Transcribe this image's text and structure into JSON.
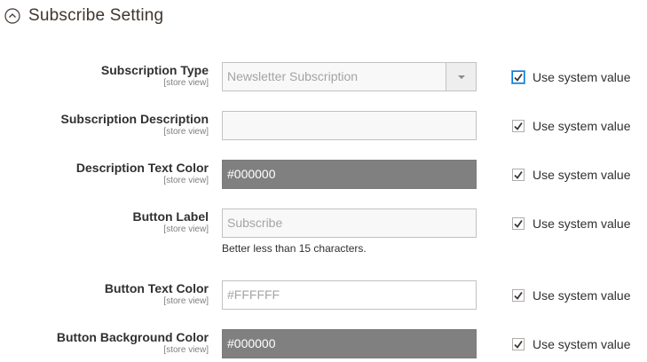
{
  "section": {
    "title": "Subscribe Setting",
    "icon": "collapse-circle-icon"
  },
  "fields": [
    {
      "label": "Subscription Type",
      "scope": "[store view]",
      "value": "Newsletter Subscription",
      "use_system": "Use system value",
      "checked": true
    },
    {
      "label": "Subscription Description",
      "scope": "[store view]",
      "value": "",
      "use_system": "Use system value",
      "checked": true
    },
    {
      "label": "Description Text Color",
      "scope": "[store view]",
      "value": "#000000",
      "use_system": "Use system value",
      "checked": true
    },
    {
      "label": "Button Label",
      "scope": "[store view]",
      "value": "Subscribe",
      "note": "Better less than 15 characters.",
      "use_system": "Use system value",
      "checked": true
    },
    {
      "label": "Button Text Color",
      "scope": "[store view]",
      "value": "#FFFFFF",
      "use_system": "Use system value",
      "checked": true
    },
    {
      "label": "Button Background Color",
      "scope": "[store view]",
      "value": "#000000",
      "use_system": "Use system value",
      "checked": true
    }
  ],
  "colors": {
    "dark_field_bg": "#808080",
    "checkbox_focus": "#007bdb",
    "title": "#41362f"
  }
}
